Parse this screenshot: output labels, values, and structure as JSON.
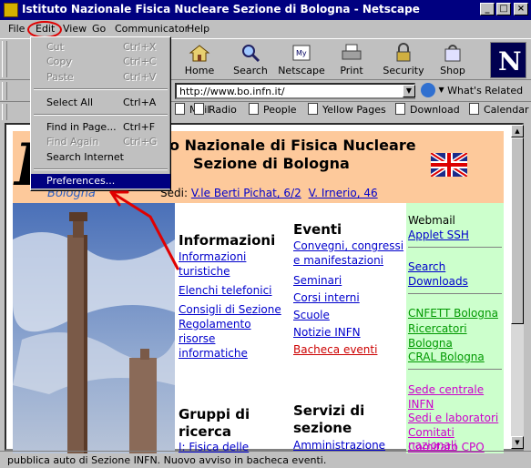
{
  "window": {
    "title": "Istituto Nazionale Fisica Nucleare Sezione di Bologna - Netscape",
    "controls": [
      "_",
      "□",
      "×"
    ]
  },
  "menubar": [
    "File",
    "Edit",
    "View",
    "Go",
    "Communicator",
    "Help"
  ],
  "edit_menu": [
    {
      "label": "Cut",
      "shortcut": "Ctrl+X",
      "enabled": false
    },
    {
      "label": "Copy",
      "shortcut": "Ctrl+C",
      "enabled": false
    },
    {
      "label": "Paste",
      "shortcut": "Ctrl+V",
      "enabled": false
    },
    {
      "label": "Select All",
      "shortcut": "Ctrl+A",
      "enabled": true
    },
    {
      "label": "Find in Page...",
      "shortcut": "Ctrl+F",
      "enabled": true
    },
    {
      "label": "Find Again",
      "shortcut": "Ctrl+G",
      "enabled": false
    },
    {
      "label": "Search Internet",
      "shortcut": "",
      "enabled": true
    },
    {
      "label": "Preferences...",
      "shortcut": "",
      "enabled": true,
      "selected": true
    }
  ],
  "toolbar": [
    "Home",
    "Search",
    "Netscape",
    "Print",
    "Security",
    "Shop"
  ],
  "location": {
    "url": "http://www.bo.infn.it/",
    "whats_related": "What's Related"
  },
  "personal_toolbar": [
    "Mail",
    "Radio",
    "People",
    "Yellow Pages",
    "Download",
    "Calendar"
  ],
  "page": {
    "header_line1": "o Nazionale di Fisica Nucleare",
    "header_line2": "Sezione di Bologna",
    "logo_text": "Bologna",
    "sedi_label": "Sedi:",
    "sedi": [
      "V.le Berti Pichat, 6/2",
      "V. Irnerio, 46"
    ],
    "informazioni": {
      "title": "Informazioni",
      "links": [
        "Informazioni turistiche",
        "Elenchi telefonici",
        "Consigli di Sezione",
        "Regolamento risorse informatiche"
      ]
    },
    "eventi": {
      "title": "Eventi",
      "links": [
        "Convegni, congressi e manifestazioni",
        "Seminari",
        "Corsi interni",
        "Scuole",
        "Notizie INFN"
      ],
      "highlight": "Bacheca eventi"
    },
    "gruppi": {
      "title": "Gruppi di ricerca",
      "first": "I: Fisica delle"
    },
    "servizi": {
      "title": "Servizi di sezione",
      "first": "Amministrazione"
    },
    "right": {
      "webmail": "Webmail",
      "applet": "Applet SSH",
      "search": "Search",
      "downloads": "Downloads",
      "green_links": [
        "CNFETT Bologna",
        "Ricercatori Bologna",
        "CRAL Bologna"
      ],
      "magenta_links": [
        "Sede centrale INFN",
        "Sedi e laboratori",
        "Comitati nazionali",
        "Comitato CPO"
      ]
    }
  },
  "status": "pubblica auto di Sezione INFN. Nuovo avviso  in bacheca eventi.",
  "colors": {
    "title": "#000080",
    "header": "#fdc99b",
    "right": "#ccffcc",
    "link": "#0000cc",
    "green_link": "#009900",
    "magenta_link": "#cc00cc",
    "red_link": "#cc0000",
    "annotation": "#e00000"
  }
}
